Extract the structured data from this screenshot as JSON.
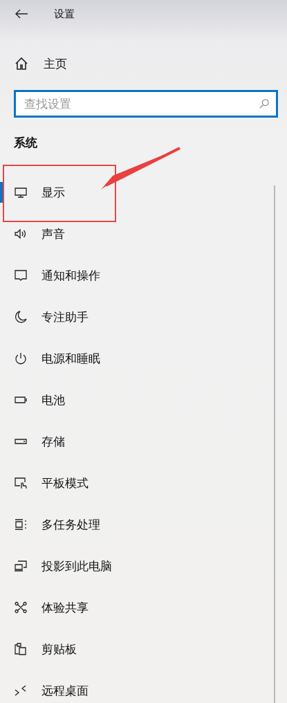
{
  "header": {
    "title": "设置"
  },
  "home": {
    "label": "主页"
  },
  "search": {
    "placeholder": "查找设置"
  },
  "section": {
    "title": "系统"
  },
  "nav_items": [
    {
      "label": "显示",
      "selected": true
    },
    {
      "label": "声音",
      "selected": false
    },
    {
      "label": "通知和操作",
      "selected": false
    },
    {
      "label": "专注助手",
      "selected": false
    },
    {
      "label": "电源和睡眠",
      "selected": false
    },
    {
      "label": "电池",
      "selected": false
    },
    {
      "label": "存储",
      "selected": false
    },
    {
      "label": "平板模式",
      "selected": false
    },
    {
      "label": "多任务处理",
      "selected": false
    },
    {
      "label": "投影到此电脑",
      "selected": false
    },
    {
      "label": "体验共享",
      "selected": false
    },
    {
      "label": "剪贴板",
      "selected": false
    },
    {
      "label": "远程桌面",
      "selected": false
    }
  ]
}
